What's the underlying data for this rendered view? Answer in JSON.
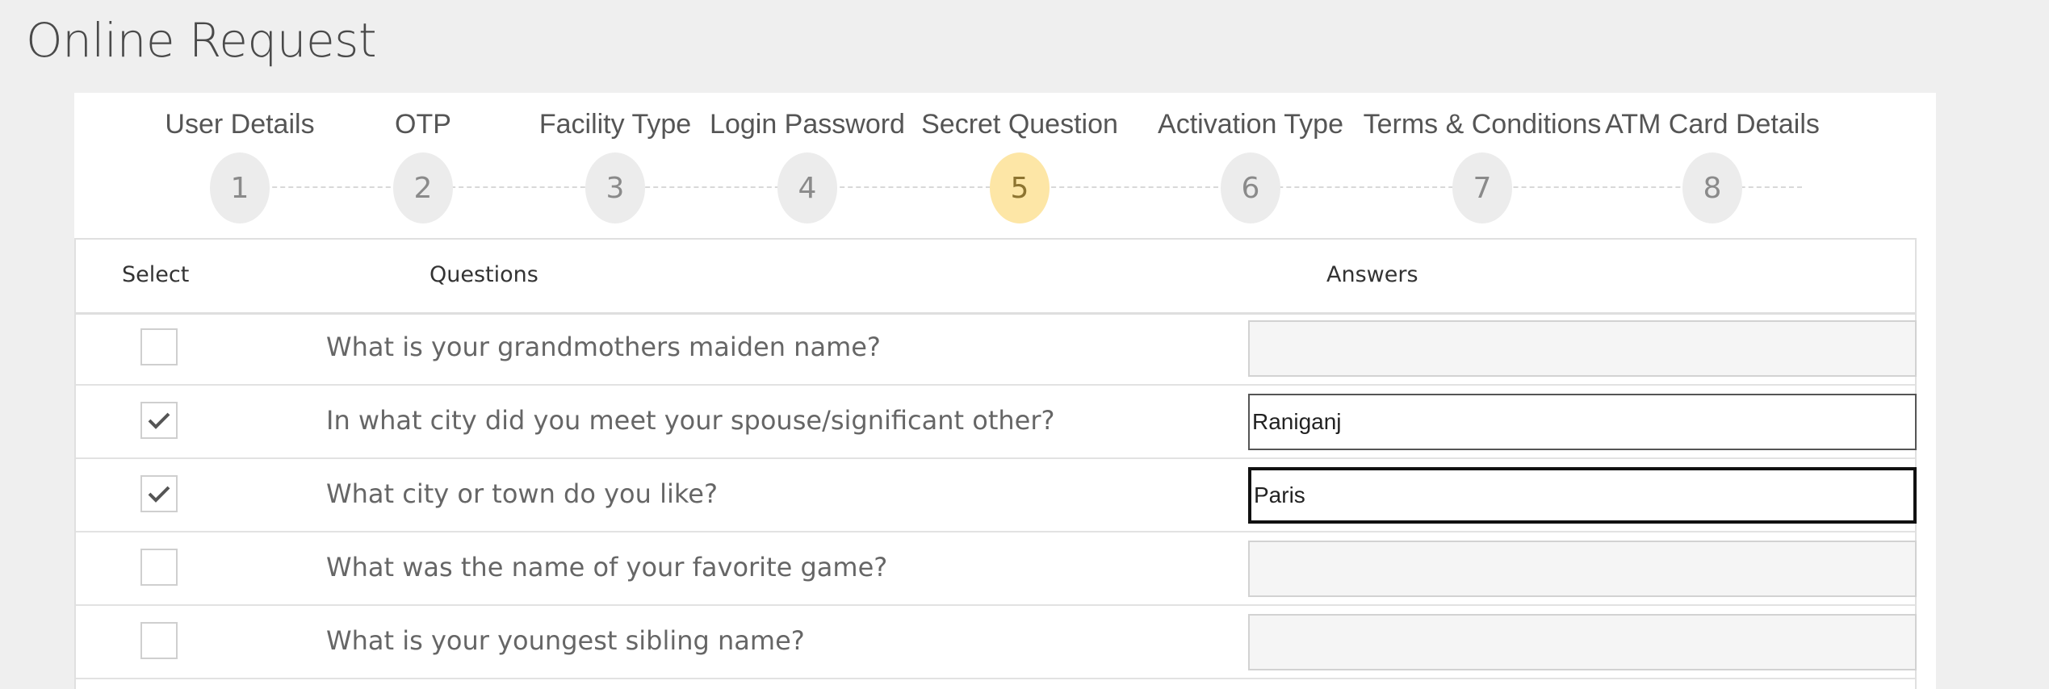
{
  "page": {
    "title": "Online Request"
  },
  "steps": [
    {
      "label": "User Details",
      "number": "1"
    },
    {
      "label": "OTP",
      "number": "2"
    },
    {
      "label": "Facility Type",
      "number": "3"
    },
    {
      "label": "Login Password",
      "number": "4"
    },
    {
      "label": "Secret Question",
      "number": "5",
      "active": true
    },
    {
      "label": "Activation Type",
      "number": "6"
    },
    {
      "label": "Terms & Conditions",
      "number": "7"
    },
    {
      "label": "ATM Card Details",
      "number": "8"
    }
  ],
  "table": {
    "headers": {
      "select": "Select",
      "questions": "Questions",
      "answers": "Answers"
    },
    "rows": [
      {
        "question": "What is your grandmothers maiden name?",
        "checked": false,
        "answer": ""
      },
      {
        "question": "In what city did you meet your spouse/significant other?",
        "checked": true,
        "answer": "Raniganj"
      },
      {
        "question": "What city or town do you like?",
        "checked": true,
        "answer": "Paris"
      },
      {
        "question": "What was the name of your favorite game?",
        "checked": false,
        "answer": ""
      },
      {
        "question": "What is your youngest sibling name?",
        "checked": false,
        "answer": ""
      }
    ]
  },
  "colors": {
    "active_step": "#fde6a6",
    "inactive_step": "#ececec"
  }
}
